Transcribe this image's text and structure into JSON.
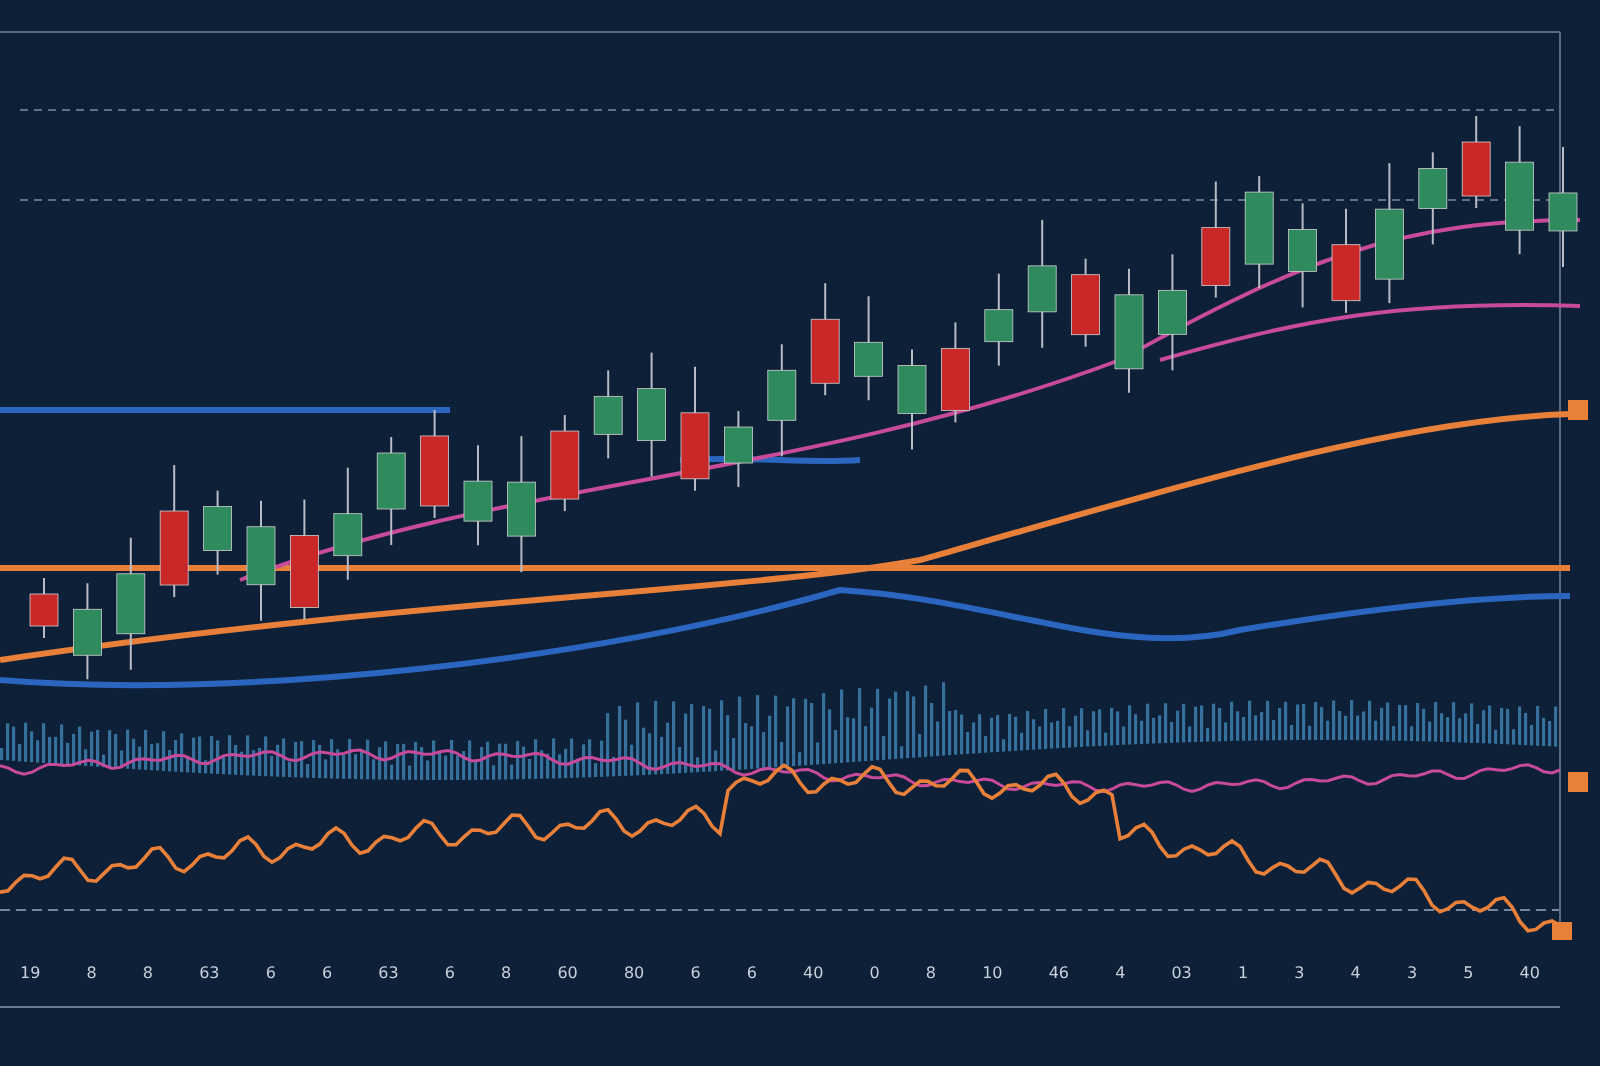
{
  "x_axis_labels": [
    "19",
    "8",
    "8",
    "63",
    "6",
    "6",
    "63",
    "6",
    "8",
    "60",
    "80",
    "6",
    "6",
    "40",
    "0",
    "8",
    "10",
    "46",
    "4",
    "03",
    "1",
    "3",
    "4",
    "3",
    "5",
    "40"
  ]
}
